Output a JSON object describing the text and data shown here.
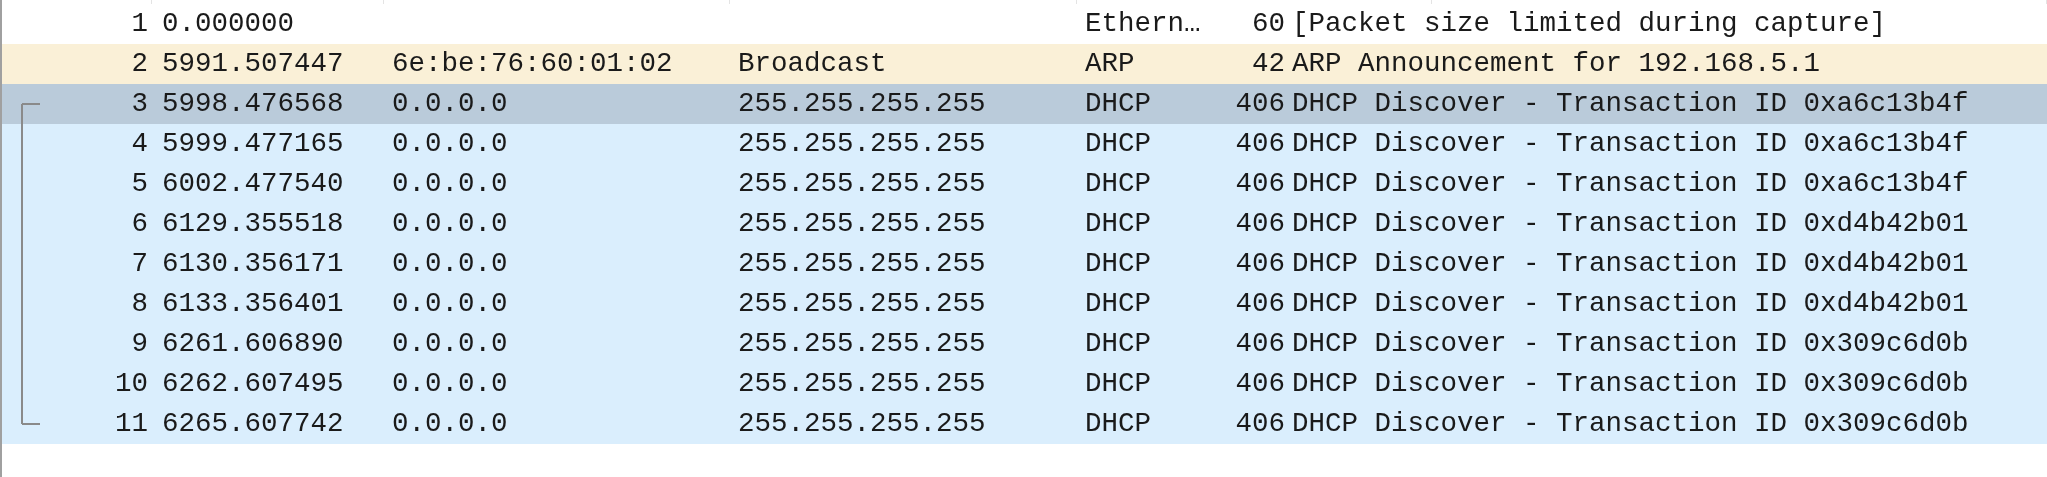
{
  "table": {
    "rows": [
      {
        "cells": [
          "1",
          "0.000000",
          "",
          "",
          "Ethern…",
          "60",
          "[Packet size limited during capture]"
        ],
        "selected": false,
        "color": "#ffffff",
        "kind": "plain"
      },
      {
        "cells": [
          "2",
          "5991.507447",
          "6e:be:76:60:01:02",
          "Broadcast",
          "ARP",
          "42",
          "ARP Announcement for 192.168.5.1"
        ],
        "selected": false,
        "color": "#faf0d7",
        "kind": "plain"
      },
      {
        "cells": [
          "3",
          "5998.476568",
          "0.0.0.0",
          "255.255.255.255",
          "DHCP",
          "406",
          "DHCP Discover - Transaction ID 0xa6c13b4f"
        ],
        "selected": true,
        "kind": "start"
      },
      {
        "cells": [
          "4",
          "5999.477165",
          "0.0.0.0",
          "255.255.255.255",
          "DHCP",
          "406",
          "DHCP Discover - Transaction ID 0xa6c13b4f"
        ],
        "selected": false,
        "color": "#daeefd",
        "kind": "middle"
      },
      {
        "cells": [
          "5",
          "6002.477540",
          "0.0.0.0",
          "255.255.255.255",
          "DHCP",
          "406",
          "DHCP Discover - Transaction ID 0xa6c13b4f"
        ],
        "selected": false,
        "color": "#daeefd",
        "kind": "middle"
      },
      {
        "cells": [
          "6",
          "6129.355518",
          "0.0.0.0",
          "255.255.255.255",
          "DHCP",
          "406",
          "DHCP Discover - Transaction ID 0xd4b42b01"
        ],
        "selected": false,
        "color": "#daeefd",
        "kind": "middle"
      },
      {
        "cells": [
          "7",
          "6130.356171",
          "0.0.0.0",
          "255.255.255.255",
          "DHCP",
          "406",
          "DHCP Discover - Transaction ID 0xd4b42b01"
        ],
        "selected": false,
        "color": "#daeefd",
        "kind": "middle"
      },
      {
        "cells": [
          "8",
          "6133.356401",
          "0.0.0.0",
          "255.255.255.255",
          "DHCP",
          "406",
          "DHCP Discover - Transaction ID 0xd4b42b01"
        ],
        "selected": false,
        "color": "#daeefd",
        "kind": "middle"
      },
      {
        "cells": [
          "9",
          "6261.606890",
          "0.0.0.0",
          "255.255.255.255",
          "DHCP",
          "406",
          "DHCP Discover - Transaction ID 0x309c6d0b"
        ],
        "selected": false,
        "color": "#daeefd",
        "kind": "middle"
      },
      {
        "cells": [
          "10",
          "6262.607495",
          "0.0.0.0",
          "255.255.255.255",
          "DHCP",
          "406",
          "DHCP Discover - Transaction ID 0x309c6d0b"
        ],
        "selected": false,
        "color": "#daeefd",
        "kind": "middle"
      },
      {
        "cells": [
          "11",
          "6265.607742",
          "0.0.0.0",
          "255.255.255.255",
          "DHCP",
          "406",
          "DHCP Discover - Transaction ID 0x309c6d0b"
        ],
        "selected": false,
        "color": "#daeefd",
        "kind": "end"
      }
    ]
  }
}
